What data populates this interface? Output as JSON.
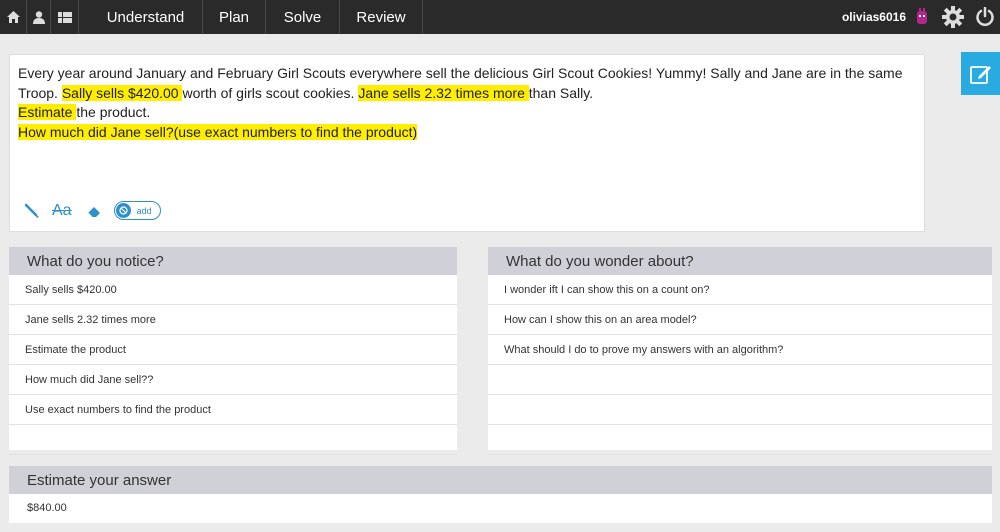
{
  "nav": {
    "tabs": [
      "Understand",
      "Plan",
      "Solve",
      "Review"
    ],
    "username": "olivias6016",
    "icons": [
      "home-icon",
      "user-icon",
      "grid-icon",
      "avatar-icon",
      "gear-icon",
      "power-icon"
    ]
  },
  "problem": {
    "segments": [
      {
        "text": "Every year around January and February Girl Scouts everywhere sell the delicious Girl Scout Cookies! Yummy! Sally and Jane are in the same Troop. ",
        "hl": false
      },
      {
        "text": "Sally sells $420.00 ",
        "hl": true
      },
      {
        "text": "worth of girls scout cookies. ",
        "hl": false
      },
      {
        "text": "Jane sells 2.32 times more ",
        "hl": true
      },
      {
        "text": "than Sally.",
        "hl": false
      }
    ],
    "line2": [
      {
        "text": "Estimate ",
        "hl": true
      },
      {
        "text": "the product.",
        "hl": false
      }
    ],
    "line3": [
      {
        "text": "How much did Jane sell?(use exact numbers to find the product)",
        "hl": true
      }
    ],
    "tools": {
      "font_label": "Aa",
      "add_label": "add"
    }
  },
  "notice": {
    "title": "What do you notice?",
    "items": [
      "Sally sells $420.00",
      "Jane sells 2.32 times more",
      "Estimate the product",
      "How much did Jane sell??",
      "Use exact numbers to find the product",
      ""
    ]
  },
  "wonder": {
    "title": "What do you wonder about?",
    "items": [
      "I wonder ift I can show this on a count on?",
      "How can I show this on an area model?",
      "What should I do to prove my answers with an algorithm?",
      "",
      "",
      ""
    ]
  },
  "estimate": {
    "title": "Estimate your answer",
    "value": "$840.00"
  },
  "colors": {
    "highlight": "#ffee00",
    "accent": "#2d8fce",
    "edit_button": "#29abe2",
    "topbar": "#2a2a2a",
    "panel_header": "#d0d0d8"
  }
}
